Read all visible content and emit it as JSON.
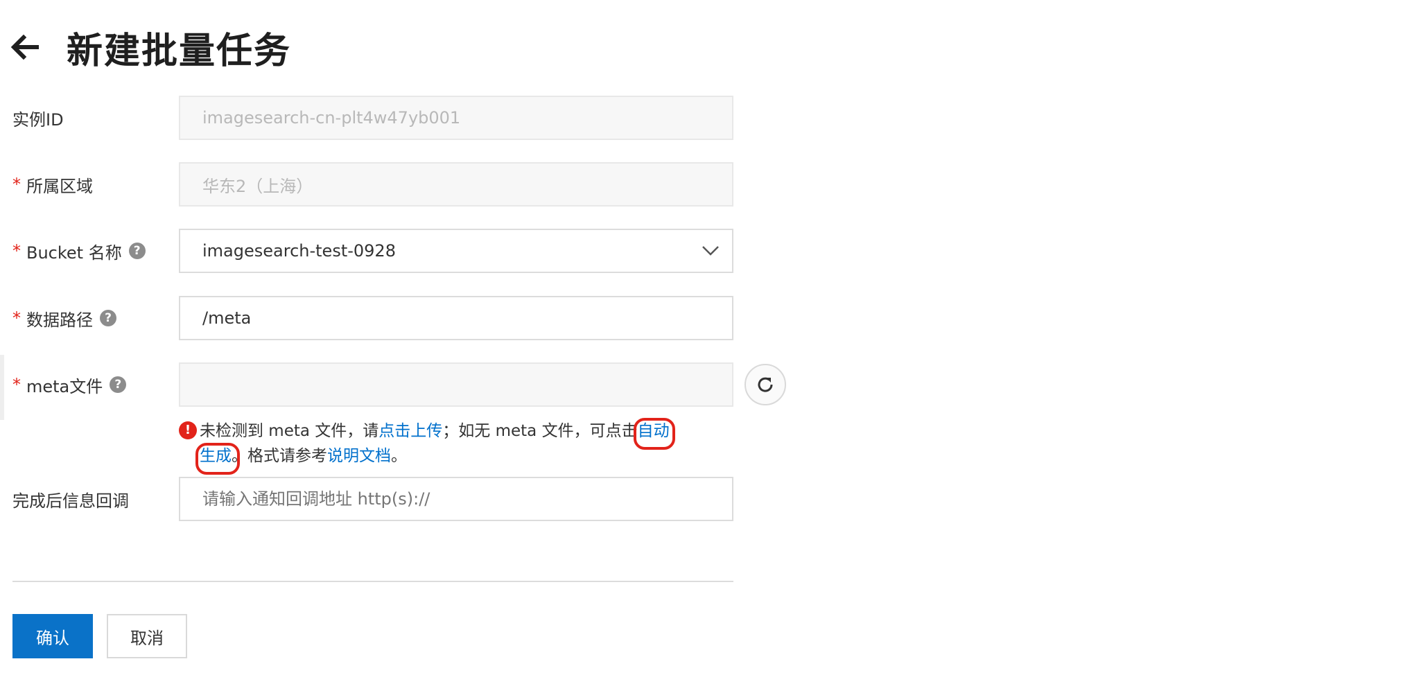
{
  "header": {
    "title": "新建批量任务",
    "back_icon": "arrow-left-icon"
  },
  "form": {
    "instance_id": {
      "label": "实例ID",
      "value": "imagesearch-cn-plt4w47yb001"
    },
    "region": {
      "required_mark": "*",
      "label": "所属区域",
      "value": "华东2（上海）"
    },
    "bucket": {
      "required_mark": "*",
      "label": "Bucket 名称",
      "help": "?",
      "value": "imagesearch-test-0928"
    },
    "data_path": {
      "required_mark": "*",
      "label": "数据路径",
      "help": "?",
      "value": "/meta"
    },
    "meta_file": {
      "required_mark": "*",
      "label": "meta文件",
      "help": "?",
      "value": ""
    },
    "callback": {
      "label": "完成后信息回调",
      "placeholder": "请输入通知回调地址 http(s)://"
    }
  },
  "error": {
    "icon": "!",
    "text_1": "未检测到 meta 文件，请",
    "link_upload": "点击上传",
    "text_2": "；如无 meta 文件，可点击",
    "link_auto_part1": "自动",
    "link_auto_part2": "生成",
    "text_3": "。格式请参考",
    "link_doc": "说明文档",
    "text_4": "。"
  },
  "buttons": {
    "confirm": "确认",
    "cancel": "取消"
  },
  "colors": {
    "primary": "#0a72c8",
    "link": "#0070cc",
    "error": "#e2231a"
  }
}
